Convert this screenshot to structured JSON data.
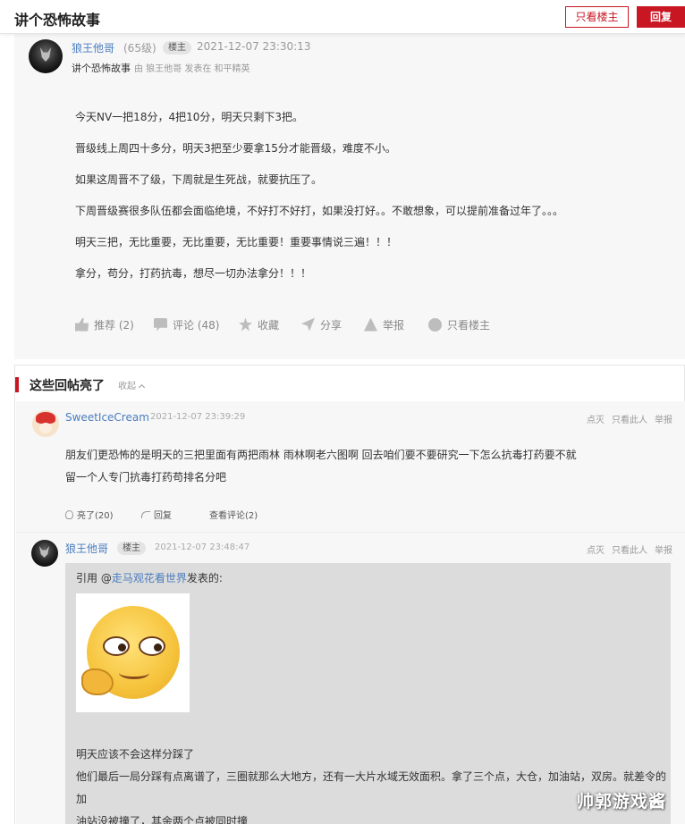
{
  "topbar": {
    "title": "讲个恐怖故事",
    "only_op_label": "只看楼主",
    "reply_label": "回复"
  },
  "main_post": {
    "author": "狼王他哥",
    "level": "(65级)",
    "op_badge": "楼主",
    "time": "2021-12-07 23:30:13",
    "title": "讲个恐怖故事",
    "meta": "由 狼王他哥 发表在 和平精英",
    "paragraphs": [
      "今天NV一把18分，4把10分，明天只剩下3把。",
      "晋级线上周四十多分，明天3把至少要拿15分才能晋级，难度不小。",
      "如果这周晋不了级，下周就是生死战，就要抗压了。",
      "下周晋级赛很多队伍都会面临绝境，不好打不好打，如果没打好。。不敢想象，可以提前准备过年了。。。",
      "明天三把，无比重要，无比重要，无比重要！重要事情说三遍！！！",
      "拿分，苟分，打药抗毒，想尽一切办法拿分！！！"
    ],
    "actions": {
      "like": "推荐 (2)",
      "comment": "评论 (48)",
      "favorite": "收藏",
      "share": "分享",
      "report": "举报",
      "only_op": "只看楼主"
    },
    "icons": [
      "thumbs-up-icon",
      "comment-icon",
      "star-icon",
      "share-icon",
      "warning-icon",
      "op-icon"
    ]
  },
  "hot_replies": {
    "title": "这些回帖亮了",
    "collapse_label": "收起"
  },
  "reply1": {
    "author": "SweetIceCream",
    "time": "2021-12-07 23:39:29",
    "ops": {
      "dislike": "点灭",
      "only_this": "只看此人",
      "report": "举报"
    },
    "lines": [
      "朋友们更恐怖的是明天的三把里面有两把雨林 雨林啊老六图啊 回去咱们要不要研究一下怎么抗毒打药要不就",
      "留一个人专门抗毒打药苟排名分吧"
    ],
    "actions": {
      "light": "亮了(20)",
      "reply": "回复",
      "view_comments": "查看评论(2)"
    }
  },
  "reply2": {
    "author": "狼王他哥",
    "op_badge": "楼主",
    "time": "2021-12-07 23:48:47",
    "ops": {
      "dislike": "点灭",
      "only_this": "只看此人",
      "report": "举报"
    },
    "quote_prefix": "引用 @",
    "quote_user": "走马观花看世界",
    "quote_suffix": "发表的:",
    "quote_lines": [
      "明天应该不会这样分踩了",
      "他们最后一局分踩有点离谱了，三圈就那么大地方，还有一大片水域无效面积。拿了三个点，大仓，加油站，双房。就差令的加",
      "油站没被撞了，其余两个点被同时撞"
    ]
  },
  "watermark": "帅郭游戏酱",
  "colors": {
    "accent": "#c81623",
    "link": "#4a7dbf",
    "panel": "#f7f7f7",
    "quote": "#dcdcdc"
  }
}
